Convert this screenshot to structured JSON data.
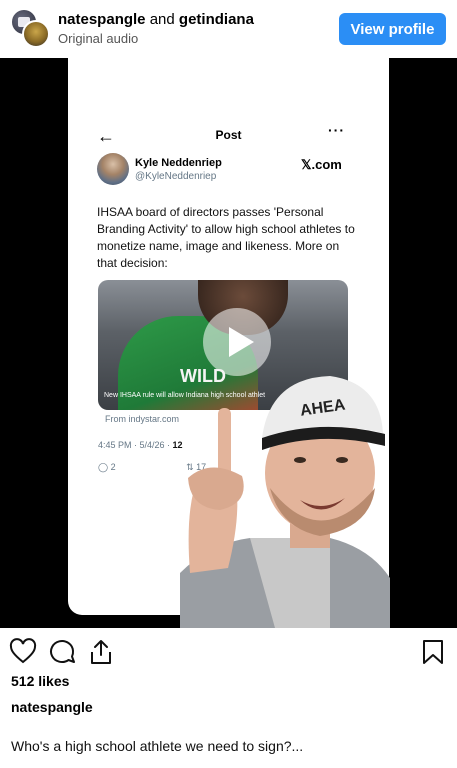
{
  "header": {
    "account_primary": "natespangle",
    "joiner": "and",
    "account_secondary": "getindiana",
    "audio_label": "Original audio",
    "view_profile_label": "View profile",
    "accent_color": "#2b8ef5"
  },
  "tweet": {
    "screen_title": "Post",
    "back_icon": "←",
    "more_icon": "···",
    "author_name": "Kyle Neddenriep",
    "author_handle": "@KyleNeddenriep",
    "brand": "𝕏.com",
    "body": "IHSAA board of directors passes 'Personal Branding Activity' to allow high school athletes to monetize name, image and likeness. More on that decision:",
    "media_caption": "New IHSAA rule will allow Indiana high school athlet",
    "jersey_text": "WILD",
    "source": "From indystar.com",
    "timestamp": "4:45 PM · 5/4/26 · ",
    "views_partial": "12",
    "replies": "2",
    "retweets": "17"
  },
  "cap_text": "AHEA",
  "actions": {
    "like_icon": "heart-outline",
    "comment_icon": "comment-bubble",
    "share_icon": "share-upload",
    "save_icon": "bookmark-outline"
  },
  "post": {
    "likes": "512 likes",
    "username": "natespangle",
    "caption": "Who's a high school athlete we need to sign?..."
  }
}
